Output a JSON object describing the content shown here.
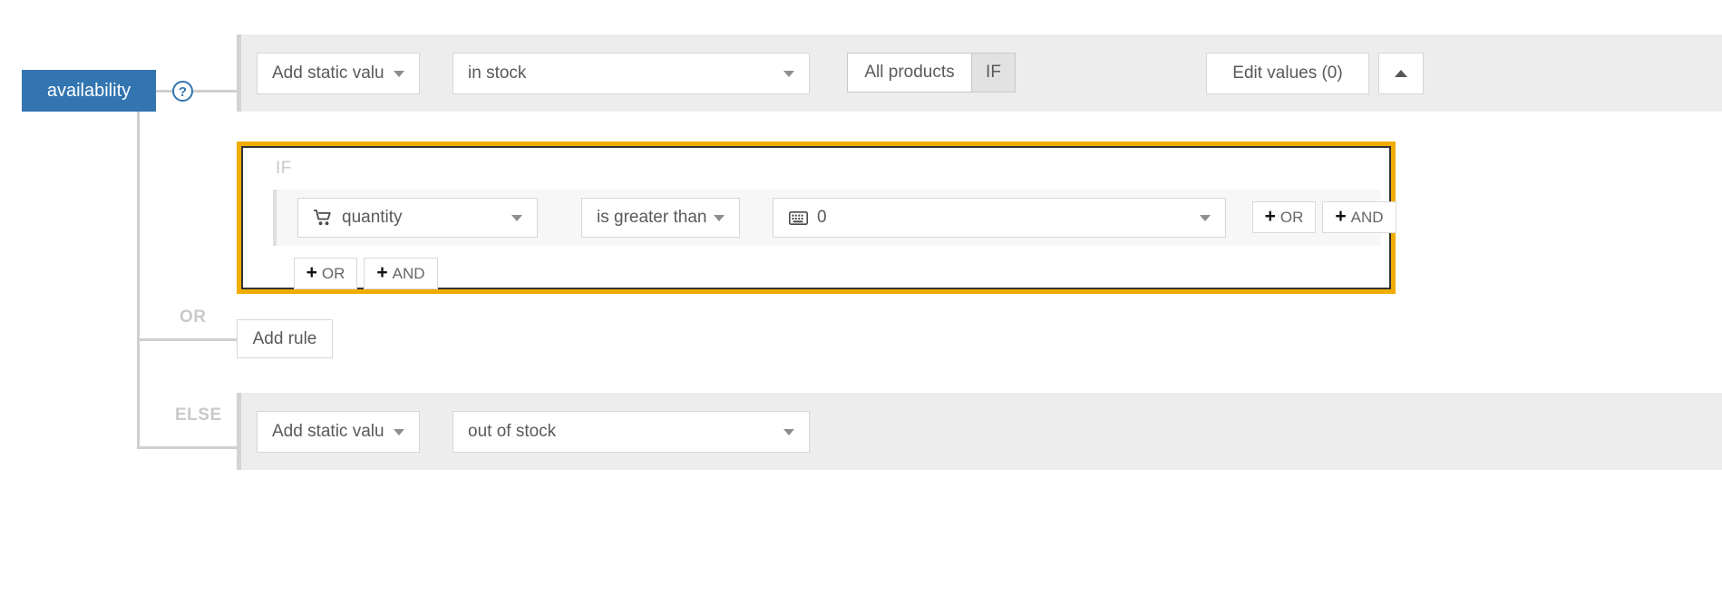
{
  "attribute": {
    "name": "availability",
    "help_icon": "question-mark-icon",
    "badge_color": "#3275b0"
  },
  "then_row": {
    "source_select": {
      "label": "Add static valu",
      "caret": "chevron-down-icon"
    },
    "value_select": {
      "label": "in stock",
      "caret": "chevron-down-icon"
    },
    "scope_toggle": {
      "options": [
        "All products",
        "IF"
      ],
      "selected": "IF"
    },
    "edit_values_button": "Edit values (0)",
    "collapse_button_icon": "chevron-up-icon"
  },
  "if_block": {
    "header_label": "IF",
    "highlight_color": "#f0ad00",
    "condition": {
      "field_select": {
        "icon": "shopping-cart-icon",
        "label": "quantity",
        "caret": "chevron-down-icon"
      },
      "operator_select": {
        "label": "is greater than",
        "caret": "chevron-down-icon"
      },
      "value_select": {
        "icon": "keyboard-icon",
        "label": "0",
        "caret": "chevron-down-icon"
      },
      "add_or_button": "OR",
      "add_and_button": "AND",
      "plus_glyph": "+"
    },
    "footer": {
      "add_or_button": "OR",
      "add_and_button": "AND",
      "plus_glyph": "+"
    }
  },
  "or_branch": {
    "label": "OR",
    "add_rule_button": "Add rule"
  },
  "else_branch": {
    "label": "ELSE",
    "source_select": {
      "label": "Add static valu",
      "caret": "chevron-down-icon"
    },
    "value_select": {
      "label": "out of stock",
      "caret": "chevron-down-icon"
    }
  }
}
